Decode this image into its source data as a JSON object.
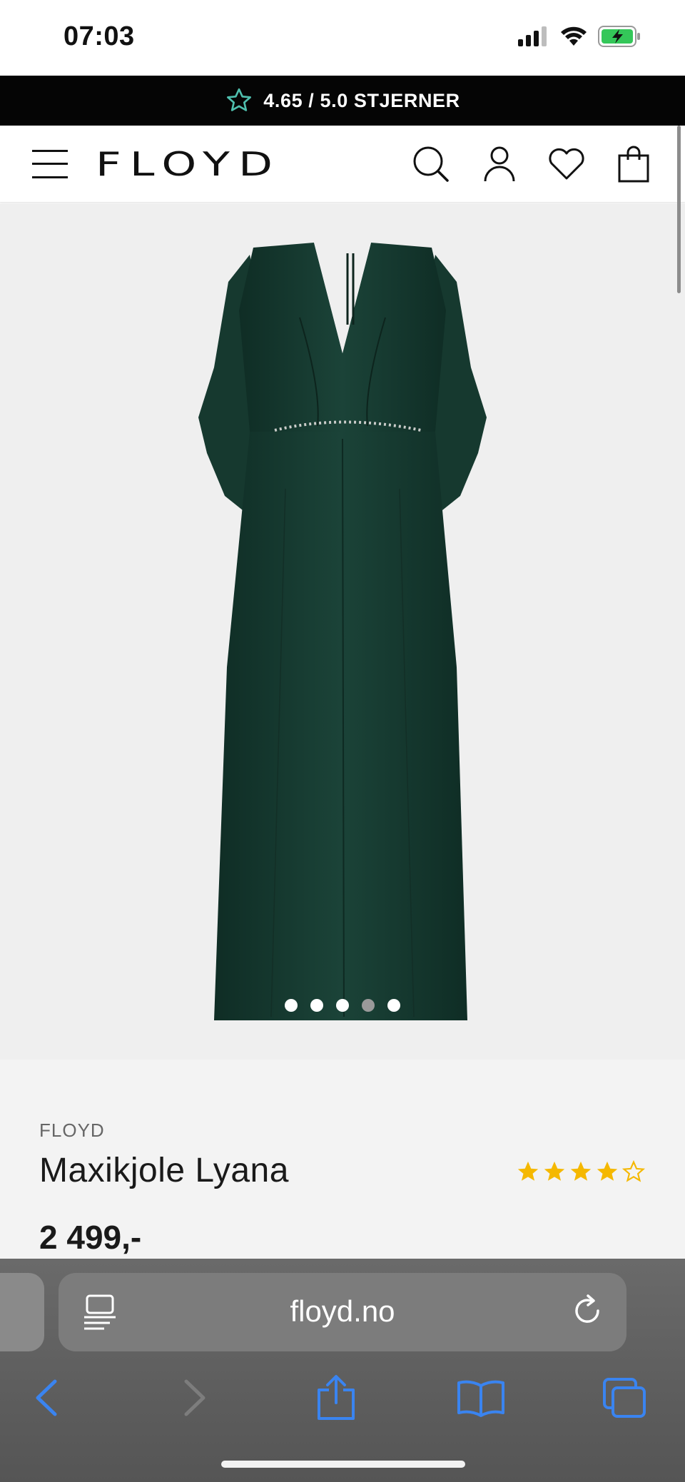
{
  "status_bar": {
    "time": "07:03"
  },
  "promo": {
    "text": "4.65 / 5.0 STJERNER"
  },
  "header": {
    "logo": "FLOYD"
  },
  "gallery": {
    "image_count": 5,
    "active_index": 3
  },
  "product": {
    "brand": "FLOYD",
    "name": "Maxikjole Lyana",
    "price": "2 499,-",
    "rating_stars": 4,
    "rating_max": 5
  },
  "browser": {
    "url": "floyd.no"
  },
  "colors": {
    "promo_bg": "#050505",
    "star_gold": "#f5b800",
    "dress_green": "#163a30",
    "browser_blue": "#3a84f0"
  }
}
